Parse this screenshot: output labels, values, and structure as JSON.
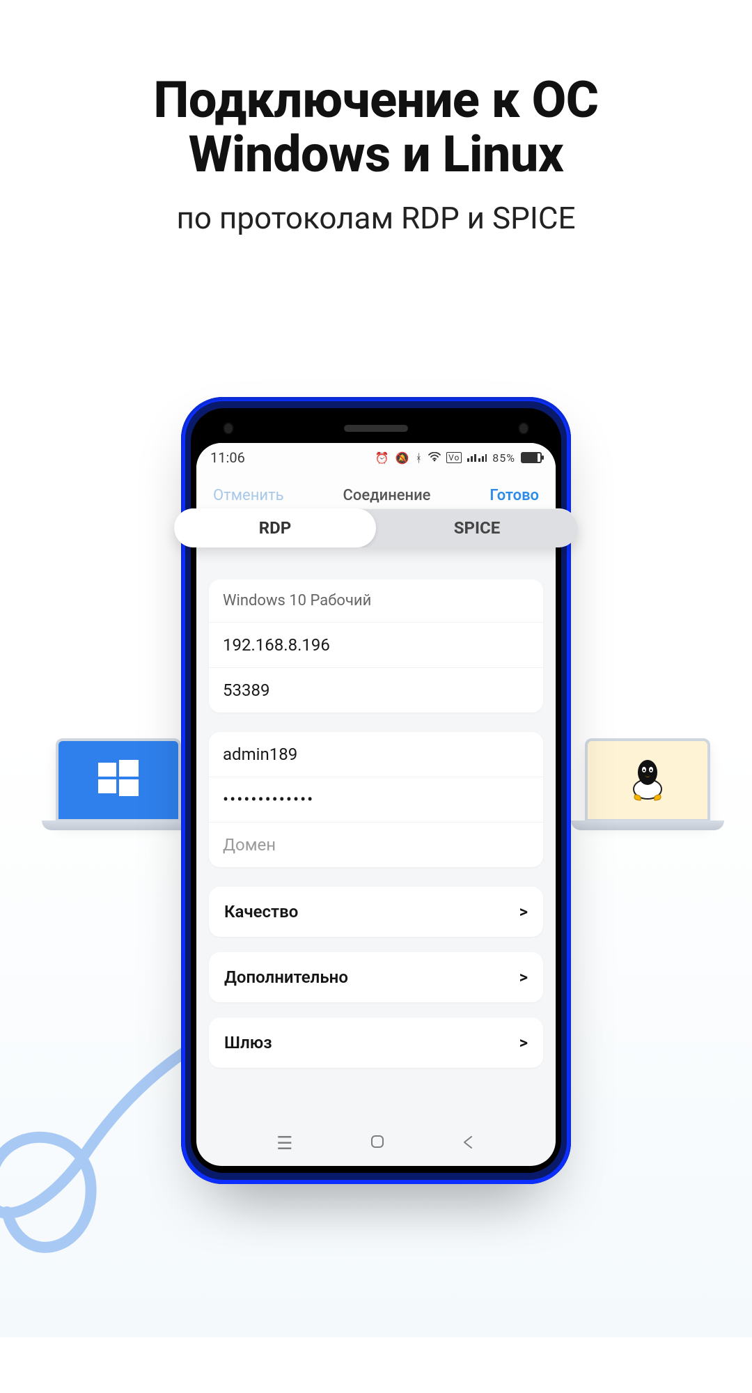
{
  "headline": {
    "title_line1": "Подключение к ОС",
    "title_line2": "Windows и Linux",
    "subtitle": "по протоколам RDP и SPICE"
  },
  "statusbar": {
    "time": "11:06",
    "battery_percent": "85%"
  },
  "nav": {
    "cancel": "Отменить",
    "title": "Соединение",
    "done": "Готово"
  },
  "segmented": {
    "rdp": "RDP",
    "spice": "SPICE"
  },
  "connection": {
    "name": "Windows 10 Рабочий",
    "host": "192.168.8.196",
    "port": "53389"
  },
  "credentials": {
    "username": "admin189",
    "password_mask": "•••••••••••••",
    "domain_placeholder": "Домен"
  },
  "links": {
    "quality": "Качество",
    "advanced": "Дополнительно",
    "gateway": "Шлюз"
  },
  "chevron": ">"
}
